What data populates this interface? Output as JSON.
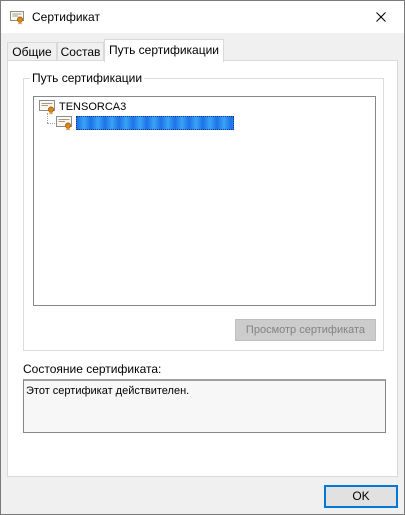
{
  "window": {
    "title": "Сертификат",
    "icons": {
      "title": "certificate-icon",
      "close": "close-icon"
    }
  },
  "tabs": [
    {
      "label": "Общие",
      "active": false
    },
    {
      "label": "Состав",
      "active": false
    },
    {
      "label": "Путь сертификации",
      "active": true
    }
  ],
  "certification_path": {
    "group_label": "Путь сертификации",
    "nodes": [
      {
        "label": "TENSORCA3",
        "icon": "certificate-icon"
      },
      {
        "label": "",
        "icon": "certificate-icon",
        "selected": true,
        "redacted": true
      }
    ],
    "view_button_label": "Просмотр сертификата",
    "view_button_enabled": false
  },
  "status": {
    "label": "Состояние сертификата:",
    "text": "Этот сертификат действителен."
  },
  "buttons": {
    "ok_label": "OK"
  },
  "colors": {
    "accent": "#0078d7",
    "selection_redaction": "#2f8be6",
    "certificate_seal": "#d98a1c"
  }
}
